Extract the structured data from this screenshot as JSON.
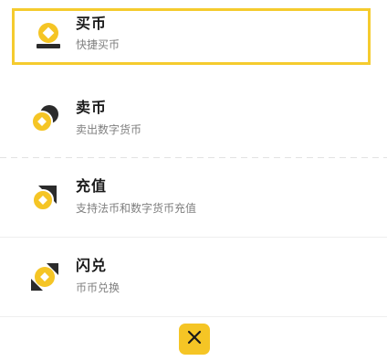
{
  "menu": {
    "items": [
      {
        "title": "买币",
        "subtitle": "快捷买币",
        "icon": "buy-coin-icon"
      },
      {
        "title": "卖币",
        "subtitle": "卖出数字货币",
        "icon": "sell-coin-icon"
      },
      {
        "title": "充值",
        "subtitle": "支持法币和数字货币充值",
        "icon": "deposit-icon"
      },
      {
        "title": "闪兑",
        "subtitle": "币币兑换",
        "icon": "swap-icon"
      }
    ]
  },
  "close_button": {
    "icon": "close-icon"
  },
  "colors": {
    "accent": "#f5c525",
    "highlight_border": "#f5cb2e",
    "icon_dark": "#2b2b2b",
    "title": "#1a1a1a",
    "subtitle": "#7f7f7f"
  }
}
